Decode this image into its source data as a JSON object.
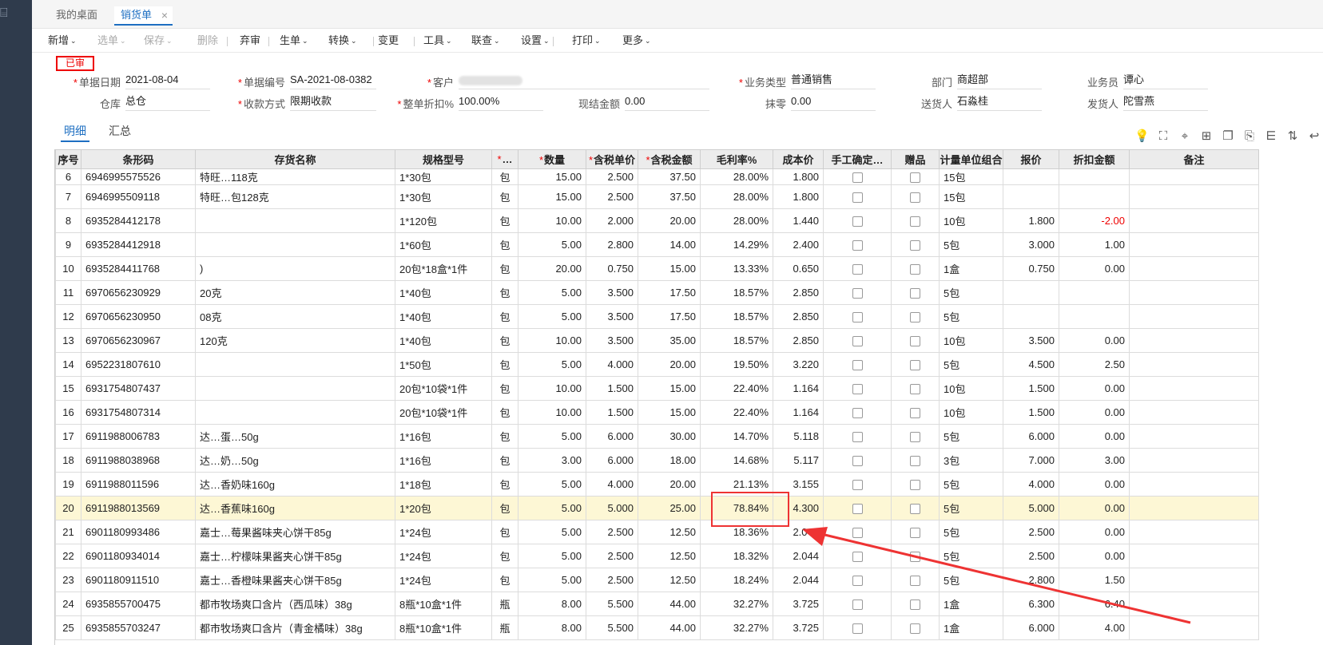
{
  "tabs": [
    {
      "label": "我的桌面"
    },
    {
      "label": "销货单",
      "close": "×"
    }
  ],
  "toolbar": {
    "items": [
      {
        "label": "新增",
        "caret": true,
        "disabled": false
      },
      {
        "label": "选单",
        "caret": true,
        "disabled": true
      },
      {
        "label": "保存",
        "caret": true,
        "disabled": true
      },
      {
        "label": "删除",
        "caret": false,
        "disabled": true
      },
      {
        "label": "弃审",
        "caret": false,
        "disabled": false
      },
      {
        "label": "生单",
        "caret": true,
        "disabled": false
      },
      {
        "label": "转换",
        "caret": true,
        "disabled": false
      },
      {
        "label": "变更",
        "caret": false,
        "disabled": false
      },
      {
        "label": "工具",
        "caret": true,
        "disabled": false
      },
      {
        "label": "联查",
        "caret": true,
        "disabled": false
      },
      {
        "label": "设置",
        "caret": true,
        "disabled": false
      },
      {
        "label": "打印",
        "caret": true,
        "disabled": false
      },
      {
        "label": "更多",
        "caret": true,
        "disabled": false
      }
    ],
    "caret_glyph": "⌄"
  },
  "status_stamp": "已审",
  "form": {
    "bill_date": {
      "label": "单据日期",
      "value": "2021-08-04",
      "required": true
    },
    "bill_no": {
      "label": "单据编号",
      "value": "SA-2021-08-0382",
      "required": true
    },
    "customer": {
      "label": "客户",
      "value": "",
      "required": true
    },
    "biz_type": {
      "label": "业务类型",
      "value": "普通销售",
      "required": true
    },
    "dept": {
      "label": "部门",
      "value": "商超部",
      "required": false
    },
    "salesman": {
      "label": "业务员",
      "value": "谭心",
      "required": false
    },
    "warehouse": {
      "label": "仓库",
      "value": "总仓",
      "required": false
    },
    "pay_method": {
      "label": "收款方式",
      "value": "限期收款",
      "required": true
    },
    "discount": {
      "label": "整单折扣%",
      "value": "100.00%",
      "required": true
    },
    "cash": {
      "label": "现结金额",
      "value": "0.00",
      "required": false
    },
    "rounding": {
      "label": "抹零",
      "value": "0.00",
      "required": false
    },
    "deliverer": {
      "label": "送货人",
      "value": "石淼桂",
      "required": false
    },
    "shipper": {
      "label": "发货人",
      "value": "陀雪燕",
      "required": false
    }
  },
  "subtabs": [
    "明细",
    "汇总"
  ],
  "right_icons": [
    "lightbulb-icon",
    "scan-icon",
    "location-icon",
    "add-row-icon",
    "copy-icon",
    "export-icon",
    "filter-icon",
    "sort-icon",
    "collapse-icon"
  ],
  "table": {
    "headers": [
      "序号",
      "条形码",
      "存货名称",
      "规格型号",
      "…",
      "数量",
      "含税单价",
      "含税金额",
      "毛利率%",
      "成本价",
      "手工确定…",
      "赠品",
      "计量单位组合",
      "报价",
      "折扣金额",
      "备注"
    ],
    "required_headers": [
      4,
      5,
      6,
      7
    ],
    "rows": [
      {
        "no": "6",
        "barcode": "6946995575526",
        "name": "特旺…118克",
        "spec": "1*30包",
        "unit": "包",
        "qty": "15.00",
        "price": "2.500",
        "amount": "37.50",
        "margin": "28.00%",
        "cost": "1.800",
        "unitgrp": "15包",
        "quote": "",
        "disc": "",
        "note": ""
      },
      {
        "no": "7",
        "barcode": "6946995509118",
        "name": "特旺…包128克",
        "spec": "1*30包",
        "unit": "包",
        "qty": "15.00",
        "price": "2.500",
        "amount": "37.50",
        "margin": "28.00%",
        "cost": "1.800",
        "unitgrp": "15包",
        "quote": "",
        "disc": "",
        "note": ""
      },
      {
        "no": "8",
        "barcode": "6935284412178",
        "name": "",
        "spec": "1*120包",
        "unit": "包",
        "qty": "10.00",
        "price": "2.000",
        "amount": "20.00",
        "margin": "28.00%",
        "cost": "1.440",
        "unitgrp": "10包",
        "quote": "1.800",
        "disc": "-2.00",
        "note": ""
      },
      {
        "no": "9",
        "barcode": "6935284412918",
        "name": "",
        "spec": "1*60包",
        "unit": "包",
        "qty": "5.00",
        "price": "2.800",
        "amount": "14.00",
        "margin": "14.29%",
        "cost": "2.400",
        "unitgrp": "5包",
        "quote": "3.000",
        "disc": "1.00",
        "note": ""
      },
      {
        "no": "10",
        "barcode": "6935284411768",
        "name": ")",
        "spec": "20包*18盒*1件",
        "unit": "包",
        "qty": "20.00",
        "price": "0.750",
        "amount": "15.00",
        "margin": "13.33%",
        "cost": "0.650",
        "unitgrp": "1盒",
        "quote": "0.750",
        "disc": "0.00",
        "note": ""
      },
      {
        "no": "11",
        "barcode": "6970656230929",
        "name": "20克",
        "spec": "1*40包",
        "unit": "包",
        "qty": "5.00",
        "price": "3.500",
        "amount": "17.50",
        "margin": "18.57%",
        "cost": "2.850",
        "unitgrp": "5包",
        "quote": "",
        "disc": "",
        "note": ""
      },
      {
        "no": "12",
        "barcode": "6970656230950",
        "name": "08克",
        "spec": "1*40包",
        "unit": "包",
        "qty": "5.00",
        "price": "3.500",
        "amount": "17.50",
        "margin": "18.57%",
        "cost": "2.850",
        "unitgrp": "5包",
        "quote": "",
        "disc": "",
        "note": ""
      },
      {
        "no": "13",
        "barcode": "6970656230967",
        "name": "120克",
        "spec": "1*40包",
        "unit": "包",
        "qty": "10.00",
        "price": "3.500",
        "amount": "35.00",
        "margin": "18.57%",
        "cost": "2.850",
        "unitgrp": "10包",
        "quote": "3.500",
        "disc": "0.00",
        "note": ""
      },
      {
        "no": "14",
        "barcode": "6952231807610",
        "name": "",
        "spec": "1*50包",
        "unit": "包",
        "qty": "5.00",
        "price": "4.000",
        "amount": "20.00",
        "margin": "19.50%",
        "cost": "3.220",
        "unitgrp": "5包",
        "quote": "4.500",
        "disc": "2.50",
        "note": ""
      },
      {
        "no": "15",
        "barcode": "6931754807437",
        "name": "",
        "spec": "20包*10袋*1件",
        "unit": "包",
        "qty": "10.00",
        "price": "1.500",
        "amount": "15.00",
        "margin": "22.40%",
        "cost": "1.164",
        "unitgrp": "10包",
        "quote": "1.500",
        "disc": "0.00",
        "note": ""
      },
      {
        "no": "16",
        "barcode": "6931754807314",
        "name": "",
        "spec": "20包*10袋*1件",
        "unit": "包",
        "qty": "10.00",
        "price": "1.500",
        "amount": "15.00",
        "margin": "22.40%",
        "cost": "1.164",
        "unitgrp": "10包",
        "quote": "1.500",
        "disc": "0.00",
        "note": ""
      },
      {
        "no": "17",
        "barcode": "6911988006783",
        "name": "达…蛋…50g",
        "spec": "1*16包",
        "unit": "包",
        "qty": "5.00",
        "price": "6.000",
        "amount": "30.00",
        "margin": "14.70%",
        "cost": "5.118",
        "unitgrp": "5包",
        "quote": "6.000",
        "disc": "0.00",
        "note": ""
      },
      {
        "no": "18",
        "barcode": "6911988038968",
        "name": "达…奶…50g",
        "spec": "1*16包",
        "unit": "包",
        "qty": "3.00",
        "price": "6.000",
        "amount": "18.00",
        "margin": "14.68%",
        "cost": "5.117",
        "unitgrp": "3包",
        "quote": "7.000",
        "disc": "3.00",
        "note": ""
      },
      {
        "no": "19",
        "barcode": "6911988011596",
        "name": "达…香奶味160g",
        "spec": "1*18包",
        "unit": "包",
        "qty": "5.00",
        "price": "4.000",
        "amount": "20.00",
        "margin": "21.13%",
        "cost": "3.155",
        "unitgrp": "5包",
        "quote": "4.000",
        "disc": "0.00",
        "note": ""
      },
      {
        "no": "20",
        "barcode": "6911988013569",
        "name": "达…香蕉味160g",
        "spec": "1*20包",
        "unit": "包",
        "qty": "5.00",
        "price": "5.000",
        "amount": "25.00",
        "margin": "78.84%",
        "cost": "4.300",
        "unitgrp": "5包",
        "quote": "5.000",
        "disc": "0.00",
        "note": "",
        "selected": true
      },
      {
        "no": "21",
        "barcode": "6901180993486",
        "name": "嘉士…莓果酱味夹心饼干85g",
        "spec": "1*24包",
        "unit": "包",
        "qty": "5.00",
        "price": "2.500",
        "amount": "12.50",
        "margin": "18.36%",
        "cost": "2.041",
        "unitgrp": "5包",
        "quote": "2.500",
        "disc": "0.00",
        "note": ""
      },
      {
        "no": "22",
        "barcode": "6901180934014",
        "name": "嘉士…柠檬味果酱夹心饼干85g",
        "spec": "1*24包",
        "unit": "包",
        "qty": "5.00",
        "price": "2.500",
        "amount": "12.50",
        "margin": "18.32%",
        "cost": "2.044",
        "unitgrp": "5包",
        "quote": "2.500",
        "disc": "0.00",
        "note": ""
      },
      {
        "no": "23",
        "barcode": "6901180911510",
        "name": "嘉士…香橙味果酱夹心饼干85g",
        "spec": "1*24包",
        "unit": "包",
        "qty": "5.00",
        "price": "2.500",
        "amount": "12.50",
        "margin": "18.24%",
        "cost": "2.044",
        "unitgrp": "5包",
        "quote": "2.800",
        "disc": "1.50",
        "note": ""
      },
      {
        "no": "24",
        "barcode": "6935855700475",
        "name": "都市牧场爽口含片（西瓜味）38g",
        "spec": "8瓶*10盒*1件",
        "unit": "瓶",
        "qty": "8.00",
        "price": "5.500",
        "amount": "44.00",
        "margin": "32.27%",
        "cost": "3.725",
        "unitgrp": "1盒",
        "quote": "6.300",
        "disc": "6.40",
        "note": ""
      },
      {
        "no": "25",
        "barcode": "6935855703247",
        "name": "都市牧场爽口含片（青金橘味）38g",
        "spec": "8瓶*10盒*1件",
        "unit": "瓶",
        "qty": "8.00",
        "price": "5.500",
        "amount": "44.00",
        "margin": "32.27%",
        "cost": "3.725",
        "unitgrp": "1盒",
        "quote": "6.000",
        "disc": "4.00",
        "note": ""
      }
    ]
  },
  "colors": {
    "accent": "#1e6fc2",
    "alert": "#ee2222",
    "selected_row": "#fdf7d5"
  }
}
